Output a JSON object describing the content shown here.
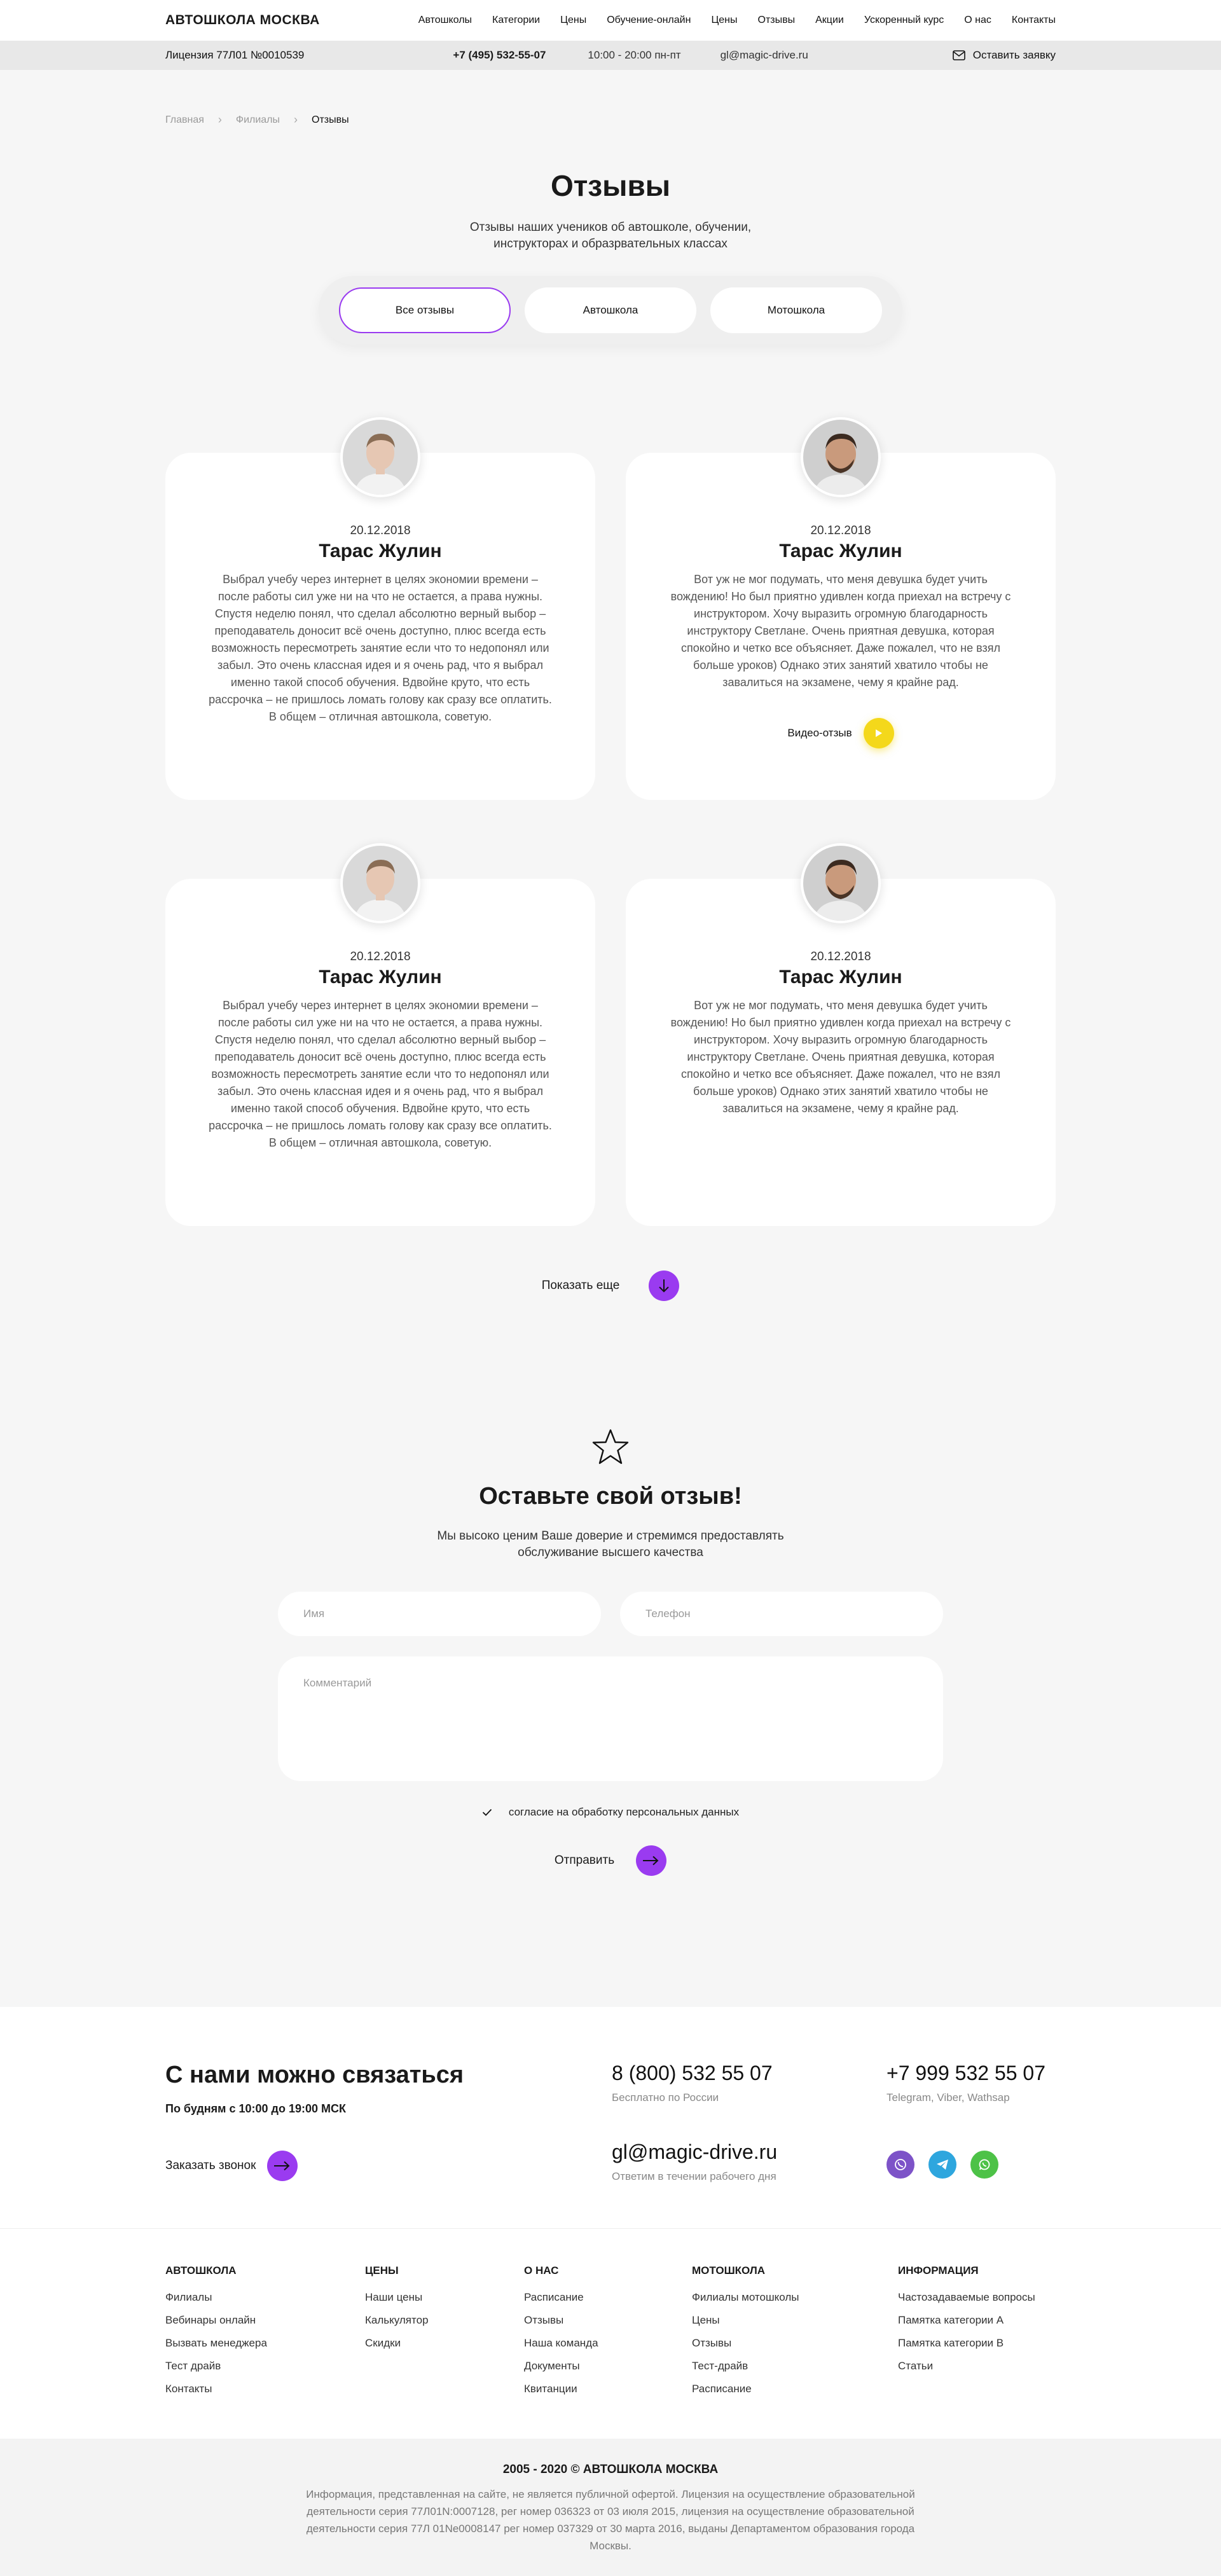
{
  "header": {
    "logo": "АВТОШКОЛА МОСКВА",
    "nav": [
      "Автошколы",
      "Категории",
      "Цены",
      "Обучение-онлайн",
      "Цены",
      "Отзывы",
      "Акции",
      "Ускоренный курс",
      "О нас",
      "Контакты"
    ]
  },
  "infobar": {
    "license": "Лицензия 77Л01 №0010539",
    "phone": "+7 (495) 532-55-07",
    "hours": "10:00 - 20:00 пн-пт",
    "email": "gl@magic-drive.ru",
    "leave_request": "Оставить заявку"
  },
  "breadcrumb": [
    "Главная",
    "Филиалы",
    "Отзывы"
  ],
  "page": {
    "title": "Отзывы",
    "subtitle": "Отзывы наших учеников об автошколе, обучении, инструкторах и образрвательных классах",
    "tabs": [
      "Все отзывы",
      "Автошкола",
      "Мотошкола"
    ],
    "active_tab": 0
  },
  "reviews": [
    {
      "date": "20.12.2018",
      "name": "Тарас Жулин",
      "text": "Выбрал учебу через интернет в целях экономии времени – после работы сил уже ни на что не остается, а права нужны. Спустя неделю понял, что сделал абсолютно верный выбор – преподаватель доносит всё очень доступно, плюс всегда есть возможность пересмотреть занятие если что то недопонял или забыл. Это очень классная идея и я очень рад, что я выбрал именно такой способ обучения. Вдвойне круто, что есть рассрочка – не пришлось ломать голову как сразу все оплатить. В общем – отличная автошкола, советую.",
      "video_label": ""
    },
    {
      "date": "20.12.2018",
      "name": "Тарас Жулин",
      "text": "Вот уж не мог подумать, что меня девушка будет учить вождению! Но был приятно удивлен когда приехал на встречу с инструктором. Хочу выразить огромную благодарность инструктору Светлане. Очень приятная девушка, которая спокойно и четко все объясняет. Даже пожалел, что не взял больше уроков) Однако этих занятий хватило чтобы не завалиться на экзамене, чему я крайне рад.",
      "video_label": "Видео-отзыв"
    },
    {
      "date": "20.12.2018",
      "name": "Тарас Жулин",
      "text": "Выбрал учебу через интернет в целях экономии времени – после работы сил уже ни на что не остается, а права нужны. Спустя неделю понял, что сделал абсолютно верный выбор – преподаватель доносит всё очень доступно, плюс всегда есть возможность пересмотреть занятие если что то недопонял или забыл. Это очень классная идея и я очень рад, что я выбрал именно такой способ обучения. Вдвойне круто, что есть рассрочка – не пришлось ломать голову как сразу все оплатить. В общем – отличная автошкола, советую.",
      "video_label": ""
    },
    {
      "date": "20.12.2018",
      "name": "Тарас Жулин",
      "text": "Вот уж не мог подумать, что меня девушка будет учить вождению! Но был приятно удивлен когда приехал на встречу с инструктором. Хочу выразить огромную благодарность инструктору Светлане. Очень приятная девушка, которая спокойно и четко все объясняет. Даже пожалел, что не взял больше уроков) Однако этих занятий хватило чтобы не завалиться на экзамене, чему я крайне рад.",
      "video_label": ""
    }
  ],
  "show_more": "Показать еще",
  "feedback": {
    "title": "Оставьте свой отзыв!",
    "description": "Мы высоко ценим Ваше доверие и стремимся предоставлять обслуживание высшего качества",
    "name_placeholder": "Имя",
    "phone_placeholder": "Телефон",
    "comment_placeholder": "Комментарий",
    "consent": "согласие на обработку персональных данных",
    "submit": "Отправить"
  },
  "contacts": {
    "title": "С нами можно связаться",
    "schedule": "По будням с 10:00 до 19:00 МСК",
    "callback": "Заказать звонок",
    "phone1": "8 (800) 532 55 07",
    "phone1_note": "Бесплатно по России",
    "phone2": "+7 999 532 55 07",
    "phone2_note": "Telegram, Viber, Wathsap",
    "email": "gl@magic-drive.ru",
    "email_note": "Ответим в течении рабочего дня",
    "socials": [
      "viber-icon",
      "telegram-icon",
      "whatsapp-icon"
    ]
  },
  "footer": {
    "columns": [
      {
        "title": "АВТОШКОЛА",
        "links": [
          "Филиалы",
          "Вебинары онлайн",
          "Вызвать менеджера",
          "Тест драйв",
          "Контакты"
        ]
      },
      {
        "title": "ЦЕНЫ",
        "links": [
          "Наши цены",
          "Калькулятор",
          "Скидки"
        ]
      },
      {
        "title": "О НАС",
        "links": [
          "Расписание",
          "Отзывы",
          "Наша команда",
          "Документы",
          "Квитанции"
        ]
      },
      {
        "title": "МОТОШКОЛА",
        "links": [
          "Филиалы мотошколы",
          "Цены",
          "Отзывы",
          "Тест-драйв",
          "Расписание"
        ]
      },
      {
        "title": "ИНФОРМАЦИЯ",
        "links": [
          "Частозадаваемые вопросы",
          "Памятка категории А",
          "Памятка категории В",
          "Статьи"
        ]
      }
    ],
    "copyright": "2005 - 2020 © АВТОШКОЛА МОСКВА",
    "legal": "Информация, представленная на сайте, не является публичной офертой. Лицензия на осуществление образовательной деятельности серия 77Л01N:0007128, рег номер 036323 от 03 июля 2015, лицензия на осуществление образовательной деятельности серия 77Л 01Nе0008147 рег номер 037329 от 30 марта 2016, выданы Департаментом образования города Москвы."
  },
  "colors": {
    "accent": "#9a3bf0",
    "play": "#f4d81b",
    "viber": "#7d53c8",
    "telegram": "#2ea6de",
    "whatsapp": "#4dc247"
  }
}
